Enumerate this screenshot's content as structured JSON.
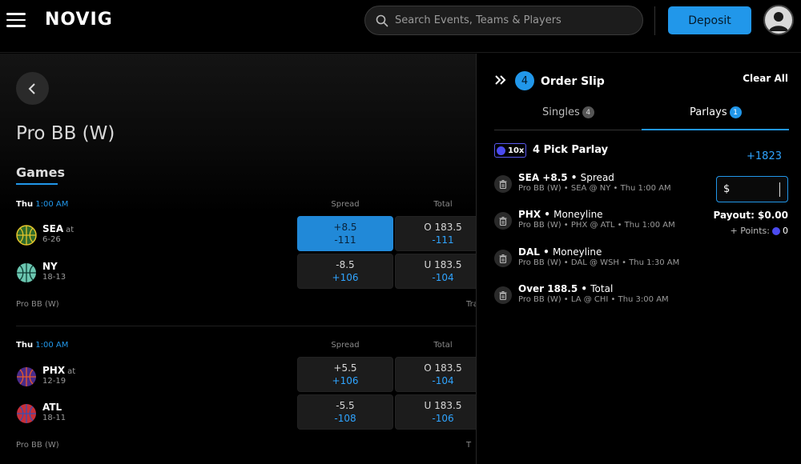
{
  "header": {
    "logo": "NOVIG",
    "search_placeholder": "Search Events, Teams & Players",
    "deposit_label": "Deposit"
  },
  "page": {
    "title": "Pro BB (W)",
    "games_tab": "Games",
    "col_spread": "Spread",
    "col_total": "Total"
  },
  "games": [
    {
      "day": "Thu",
      "time": "1:00 AM",
      "league": "Pro BB (W)",
      "trade_label": "Tra",
      "away": {
        "name": "SEA",
        "at": "at",
        "record": "6-26",
        "color": "#2f6b2a"
      },
      "home": {
        "name": "NY",
        "record": "18-13",
        "color": "#6bc6b0"
      },
      "away_spread": {
        "line": "+8.5",
        "price": "-111",
        "selected": true
      },
      "home_spread": {
        "line": "-8.5",
        "price": "+106"
      },
      "away_total": {
        "line": "O 183.5",
        "price": "-111"
      },
      "home_total": {
        "line": "U 183.5",
        "price": "-104"
      }
    },
    {
      "day": "Thu",
      "time": "1:00 AM",
      "league": "Pro BB (W)",
      "trade_label": "T",
      "away": {
        "name": "PHX",
        "at": "at",
        "record": "12-19",
        "color": "#4b2b8a"
      },
      "home": {
        "name": "ATL",
        "record": "18-11",
        "color": "#c62f3a"
      },
      "away_spread": {
        "line": "+5.5",
        "price": "+106"
      },
      "home_spread": {
        "line": "-5.5",
        "price": "-108"
      },
      "away_total": {
        "line": "O 183.5",
        "price": "-104"
      },
      "home_total": {
        "line": "U 183.5",
        "price": "-106"
      }
    }
  ],
  "slip": {
    "count": "4",
    "title": "Order Slip",
    "clear_all": "Clear All",
    "tab_singles": "Singles",
    "tab_singles_count": "4",
    "tab_parlays": "Parlays",
    "tab_parlays_count": "1",
    "multiplier": "10x",
    "parlay_title": "4 Pick Parlay",
    "parlay_odds": "+1823",
    "stake_symbol": "$",
    "payout": "Payout: $0.00",
    "points_label": "+ Points:",
    "points_value": "0",
    "legs": [
      {
        "pick": "SEA +8.5",
        "type": "Spread",
        "desc": "Pro BB (W) • SEA @ NY • Thu 1:00 AM"
      },
      {
        "pick": "PHX",
        "type": "Moneyline",
        "desc": "Pro BB (W) • PHX @ ATL • Thu 1:00 AM"
      },
      {
        "pick": "DAL",
        "type": "Moneyline",
        "desc": "Pro BB (W) • DAL @ WSH • Thu 1:30 AM"
      },
      {
        "pick": "Over 188.5",
        "type": "Total",
        "desc": "Pro BB (W) • LA @ CHI • Thu 3:00 AM"
      }
    ]
  },
  "colors": {
    "accent": "#2197ea",
    "points": "#4b4bf0"
  }
}
